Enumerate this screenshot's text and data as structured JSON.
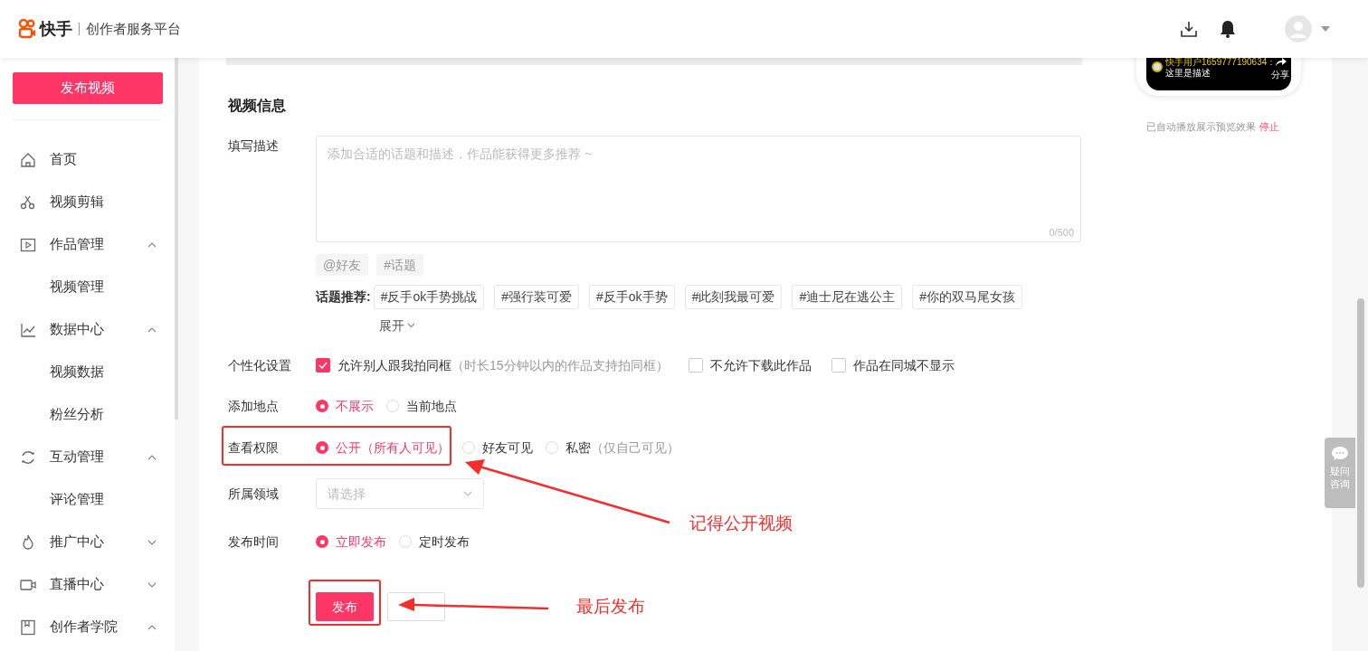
{
  "header": {
    "logo_text": "快手",
    "subtitle": "创作者服务平台"
  },
  "sidebar": {
    "publish_button": "发布视频",
    "items": [
      {
        "label": "首页"
      },
      {
        "label": "视频剪辑"
      },
      {
        "label": "作品管理",
        "expanded": true,
        "children": [
          {
            "label": "视频管理"
          }
        ]
      },
      {
        "label": "数据中心",
        "expanded": true,
        "children": [
          {
            "label": "视频数据"
          },
          {
            "label": "粉丝分析"
          }
        ]
      },
      {
        "label": "互动管理",
        "expanded": true,
        "children": [
          {
            "label": "评论管理"
          }
        ]
      },
      {
        "label": "推广中心",
        "expanded": false
      },
      {
        "label": "直播中心",
        "expanded": false
      },
      {
        "label": "创作者学院",
        "expanded": true
      }
    ]
  },
  "form": {
    "section_title": "视频信息",
    "description": {
      "label": "填写描述",
      "placeholder": "添加合适的话题和描述，作品能获得更多推荐 ~",
      "counter": "0/500"
    },
    "insert_buttons": [
      "@好友",
      "#话题"
    ],
    "topic_suggestions": {
      "label": "话题推荐:",
      "tags": [
        "#反手ok手势挑战",
        "#强行装可爱",
        "#反手ok手势",
        "#此刻我最可爱",
        "#迪士尼在逃公主",
        "#你的双马尾女孩"
      ],
      "more": "展开"
    },
    "personalization": {
      "label": "个性化设置",
      "options": [
        {
          "label": "允许别人跟我拍同框",
          "hint": "（时长15分钟以内的作品支持拍同框）",
          "checked": true
        },
        {
          "label": "不允许下载此作品",
          "checked": false
        },
        {
          "label": "作品在同城不显示",
          "checked": false
        }
      ]
    },
    "location": {
      "label": "添加地点",
      "options": [
        {
          "label": "不展示",
          "selected": true
        },
        {
          "label": "当前地点",
          "selected": false
        }
      ]
    },
    "visibility": {
      "label": "查看权限",
      "options": [
        {
          "label": "公开（所有人可见）",
          "selected": true
        },
        {
          "label": "好友可见",
          "selected": false
        },
        {
          "label": "私密",
          "hint": "（仅自己可见）",
          "selected": false
        }
      ]
    },
    "category": {
      "label": "所属领域",
      "placeholder": "请选择"
    },
    "publish_time": {
      "label": "发布时间",
      "options": [
        {
          "label": "立即发布",
          "selected": true
        },
        {
          "label": "定时发布",
          "selected": false
        }
      ]
    },
    "buttons": [
      {
        "label": "发布",
        "kind": "primary"
      },
      {
        "kind": "secondary"
      }
    ]
  },
  "preview": {
    "caption_user": "快手用户1659777190634：",
    "caption_text": "这里是描述",
    "share": "分享",
    "autoplay_note": "已自动播放展示预览效果",
    "stop_link": "停止"
  },
  "help_button": "疑问咨询",
  "annotations": [
    {
      "text": "记得公开视频"
    },
    {
      "text": "最后发布"
    }
  ]
}
